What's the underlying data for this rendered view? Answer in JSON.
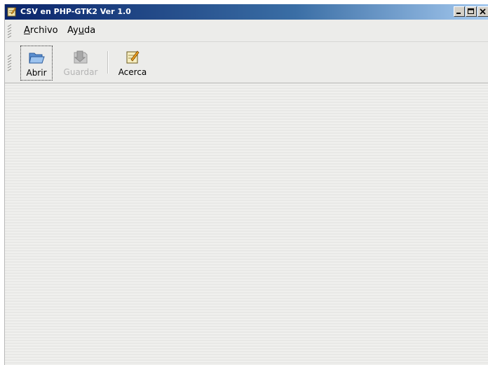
{
  "window": {
    "title": "CSV en PHP-GTK2 Ver 1.0",
    "controls": [
      "minimize",
      "maximize",
      "close"
    ]
  },
  "menubar": {
    "items": [
      {
        "label": "Archivo",
        "mnemonic": "A"
      },
      {
        "label": "Ayuda",
        "mnemonic": "u"
      }
    ]
  },
  "toolbar": {
    "buttons": [
      {
        "label": "Abrir",
        "icon": "folder-open-icon",
        "enabled": true,
        "focused": true
      },
      {
        "label": "Guardar",
        "icon": "save-icon",
        "enabled": false,
        "focused": false
      },
      {
        "label": "Acerca",
        "icon": "about-notepad-icon",
        "enabled": true,
        "focused": false
      }
    ]
  },
  "colors": {
    "titlebar_start": "#0a246a",
    "titlebar_end": "#a6caf0",
    "window_bg": "#ececea",
    "disabled_text": "#b4b4b4"
  }
}
